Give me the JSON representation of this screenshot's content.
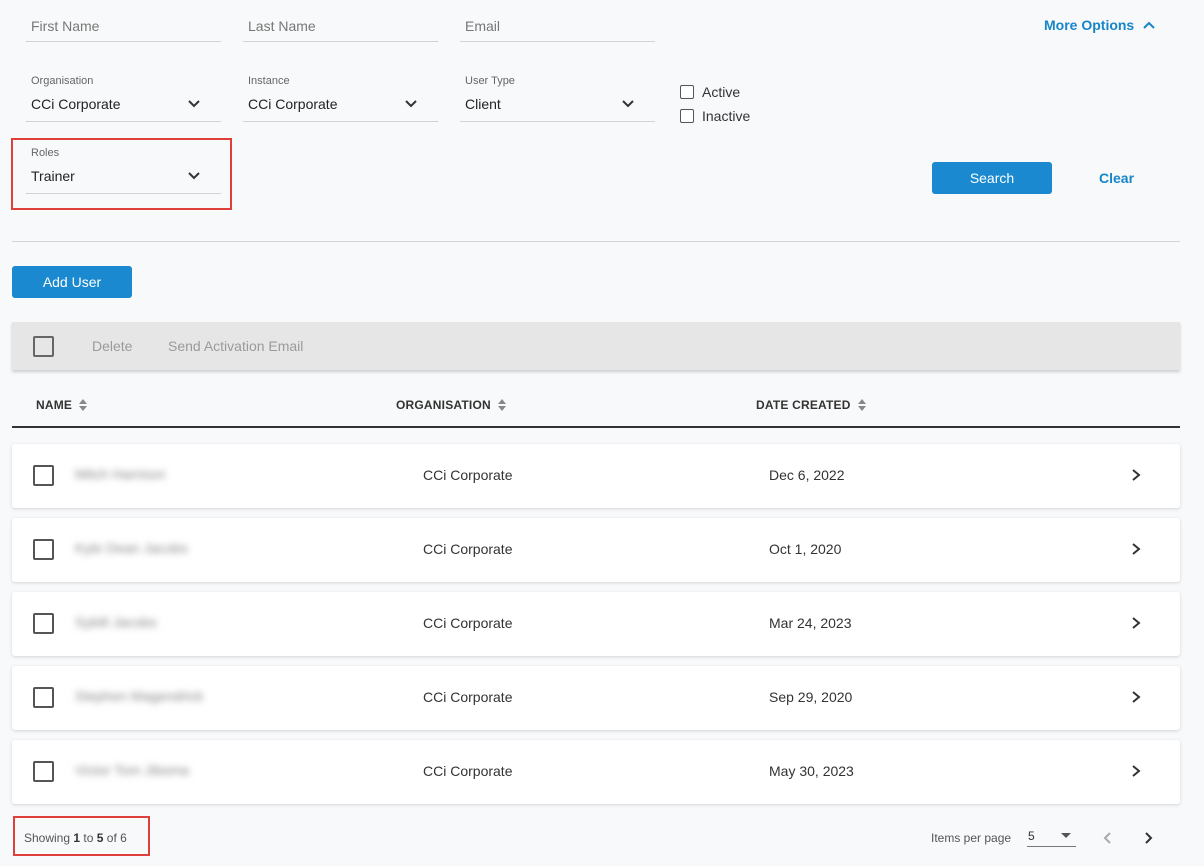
{
  "filters": {
    "first_name_placeholder": "First Name",
    "last_name_placeholder": "Last Name",
    "email_placeholder": "Email",
    "more_options_label": "More Options",
    "organisation": {
      "label": "Organisation",
      "value": "CCi Corporate"
    },
    "instance": {
      "label": "Instance",
      "value": "CCi Corporate"
    },
    "user_type": {
      "label": "User Type",
      "value": "Client"
    },
    "roles": {
      "label": "Roles",
      "value": "Trainer"
    },
    "active_label": "Active",
    "inactive_label": "Inactive",
    "search_label": "Search",
    "clear_label": "Clear"
  },
  "actions": {
    "add_user_label": "Add User",
    "delete_label": "Delete",
    "send_activation_label": "Send Activation Email"
  },
  "table": {
    "columns": [
      "NAME",
      "ORGANISATION",
      "DATE CREATED"
    ],
    "rows": [
      {
        "name": "Mitch Harrison",
        "organisation": "CCi Corporate",
        "date_created": "Dec 6, 2022"
      },
      {
        "name": "Kyle Dean Jacobs",
        "organisation": "CCi Corporate",
        "date_created": "Oct 1, 2020"
      },
      {
        "name": "Sybill Jacobs",
        "organisation": "CCi Corporate",
        "date_created": "Mar 24, 2023"
      },
      {
        "name": "Stephen Magendrick",
        "organisation": "CCi Corporate",
        "date_created": "Sep 29, 2020"
      },
      {
        "name": "Victor Tom Jibsma",
        "organisation": "CCi Corporate",
        "date_created": "May 30, 2023"
      }
    ]
  },
  "pagination": {
    "showing_prefix": "Showing",
    "from": "1",
    "to_word": "to",
    "to": "5",
    "of_word": "of",
    "total": "6",
    "items_per_page_label": "Items per page",
    "items_per_page_value": "5"
  },
  "colors": {
    "accent": "#1a89cf",
    "highlight": "#e0403c"
  },
  "icons": [
    "chevron-up-icon",
    "chevron-down-icon",
    "sort-icon",
    "chevron-right-icon",
    "chevron-left-icon"
  ]
}
